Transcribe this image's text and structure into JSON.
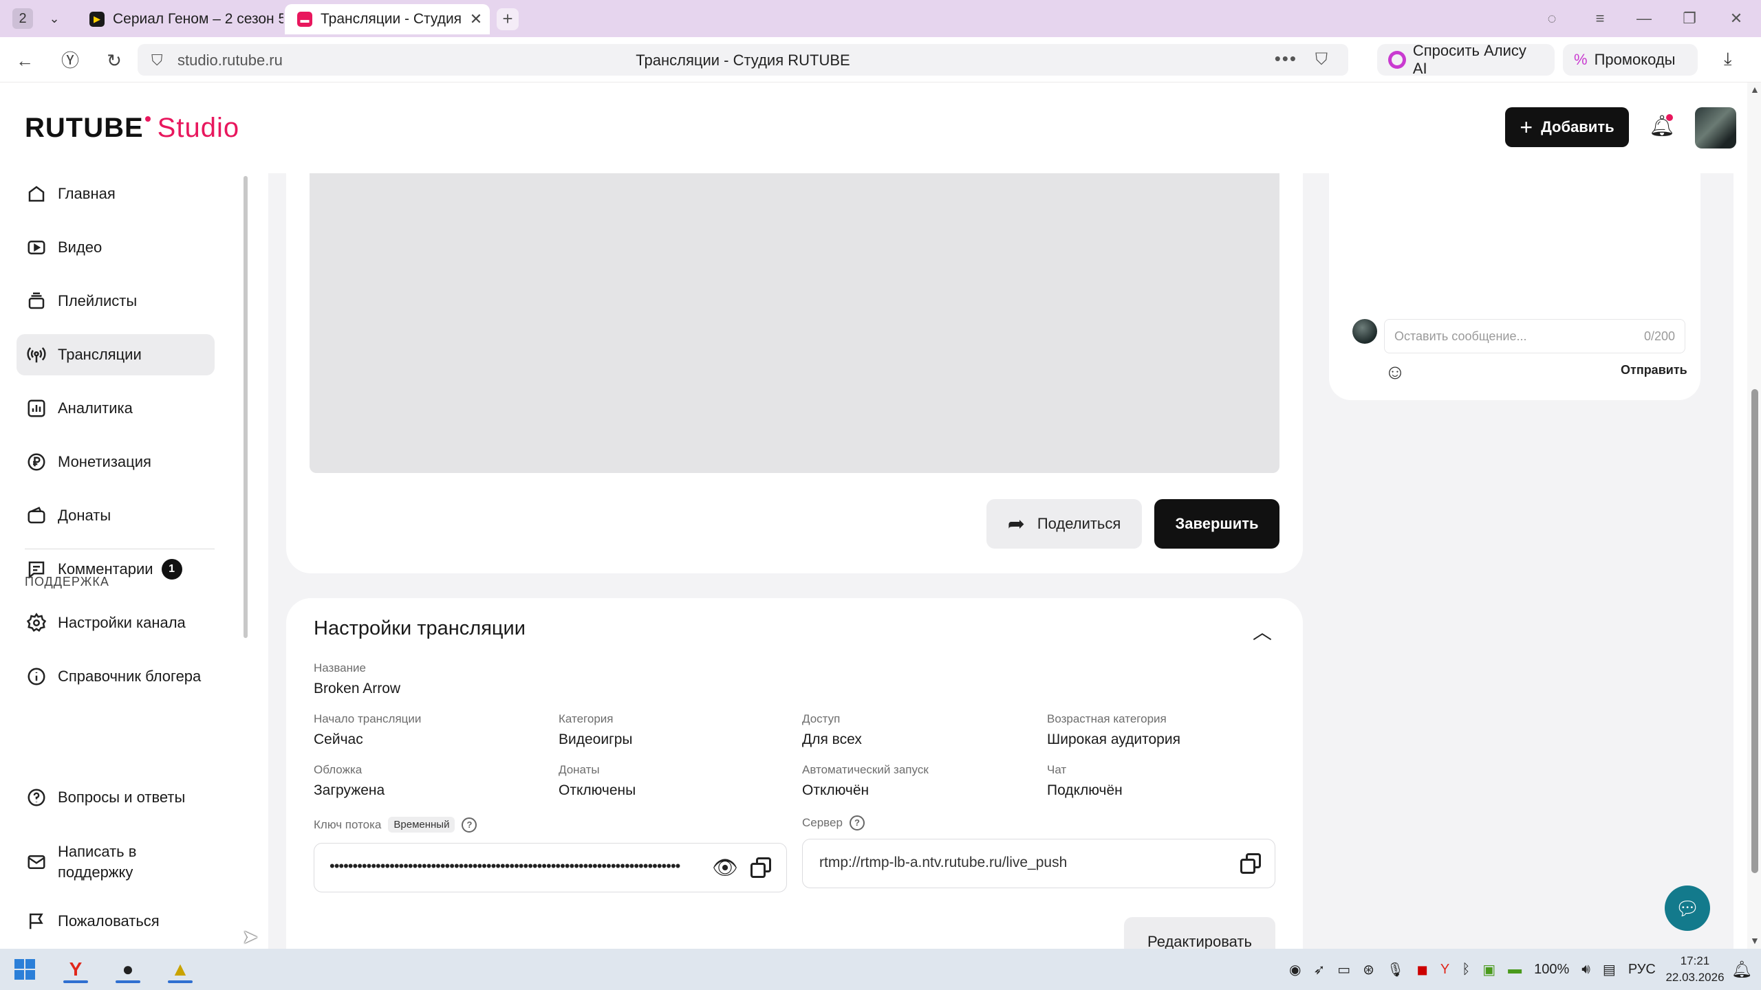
{
  "browser": {
    "tab_count": "2",
    "tabs": [
      {
        "title": "Сериал Геном – 2 сезон 5",
        "active": false
      },
      {
        "title": "Трансляции - Студия R",
        "active": true
      }
    ],
    "url": "studio.rutube.ru",
    "page_title": "Трансляции - Студия RUTUBE",
    "alice_label": "Спросить Алису AI",
    "promo_label": "Промокоды"
  },
  "header": {
    "logo_main": "RUTUBE",
    "logo_sub": "Studio",
    "add_label": "Добавить"
  },
  "sidebar": {
    "items": [
      {
        "label": "Главная",
        "icon": "home-icon"
      },
      {
        "label": "Видео",
        "icon": "video-icon"
      },
      {
        "label": "Плейлисты",
        "icon": "playlist-icon"
      },
      {
        "label": "Трансляции",
        "icon": "broadcast-icon",
        "active": true
      },
      {
        "label": "Аналитика",
        "icon": "analytics-icon"
      },
      {
        "label": "Монетизация",
        "icon": "ruble-icon"
      },
      {
        "label": "Донаты",
        "icon": "wallet-icon"
      },
      {
        "label": "Комментарии",
        "icon": "comment-icon",
        "badge": "1"
      },
      {
        "label": "Настройки канала",
        "icon": "gear-icon"
      },
      {
        "label": "Справочник блогера",
        "icon": "info-icon"
      }
    ],
    "support_title": "ПОДДЕРЖКА",
    "support_items": [
      {
        "label": "Вопросы и ответы",
        "icon": "help-icon"
      },
      {
        "label": "Написать в поддержку",
        "icon": "mail-icon"
      },
      {
        "label": "Пожаловаться",
        "icon": "flag-icon"
      }
    ]
  },
  "player": {
    "share_label": "Поделиться",
    "finish_label": "Завершить"
  },
  "chat": {
    "placeholder": "Оставить сообщение...",
    "counter": "0/200",
    "send_label": "Отправить"
  },
  "settings": {
    "title": "Настройки трансляции",
    "name_label": "Название",
    "name_value": "Broken Arrow",
    "fields": [
      {
        "label": "Начало трансляции",
        "value": "Сейчас"
      },
      {
        "label": "Категория",
        "value": "Видеоигры"
      },
      {
        "label": "Доступ",
        "value": "Для всех"
      },
      {
        "label": "Возрастная категория",
        "value": "Широкая аудитория"
      },
      {
        "label": "Обложка",
        "value": "Загружена"
      },
      {
        "label": "Донаты",
        "value": "Отключены"
      },
      {
        "label": "Автоматический запуск",
        "value": "Отключён"
      },
      {
        "label": "Чат",
        "value": "Подключён"
      }
    ],
    "key_label": "Ключ потока",
    "key_tag": "Временный",
    "key_masked": "••••••••••••••••••••••••••••••••••••••••••••••••••••••••••••••••••••••••••••",
    "server_label": "Сервер",
    "server_value": "rtmp://rtmp-lb-a.ntv.rutube.ru/live_push",
    "edit_label": "Редактировать"
  },
  "taskbar": {
    "battery": "100%",
    "lang": "РУС",
    "time": "17:21",
    "date": "22.03.2026"
  }
}
